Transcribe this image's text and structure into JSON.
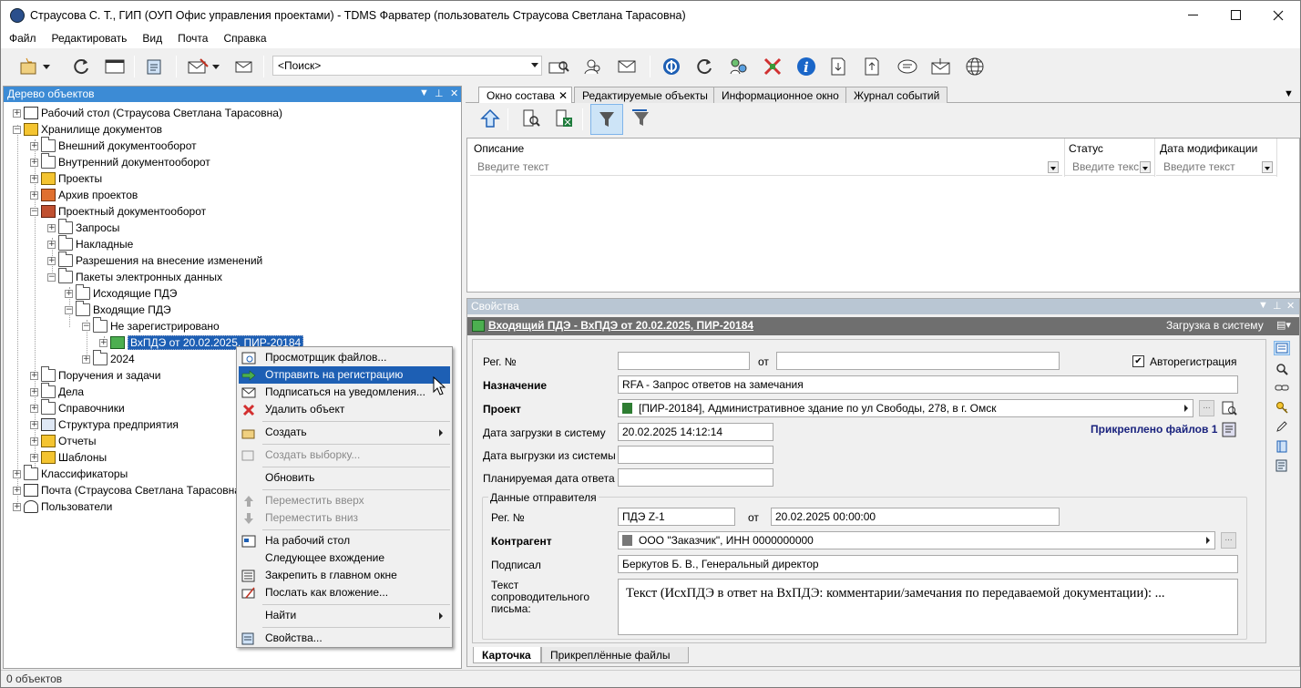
{
  "window": {
    "title": "Страусова С. Т., ГИП (ОУП Офис управления проектами) - TDMS Фарватер (пользователь Страусова Светлана Тарасовна)"
  },
  "menu": [
    "Файл",
    "Редактировать",
    "Вид",
    "Почта",
    "Справка"
  ],
  "search": {
    "value": "<Поиск>"
  },
  "tree": {
    "title": "Дерево объектов",
    "items": [
      "Рабочий стол (Страусова Светлана Тарасовна)",
      "Хранилище документов",
      "Внешний документооборот",
      "Внутренний документооборот",
      "Проекты",
      "Архив проектов",
      "Проектный документооборот",
      "Запросы",
      "Накладные",
      "Разрешения на внесение изменений",
      "Пакеты электронных данных",
      "Исходящие ПДЭ",
      "Входящие ПДЭ",
      "Не зарегистрировано",
      "ВхПДЭ от 20.02.2025, ПИР-20184",
      "2024",
      "Поручения и задачи",
      "Дела",
      "Справочники",
      "Структура предприятия",
      "Отчеты",
      "Шаблоны",
      "Классификаторы",
      "Почта (Страусова Светлана Тарасовна)",
      "Пользователи"
    ]
  },
  "tabs": [
    "Окно состава",
    "Редактируемые объекты",
    "Информационное окно",
    "Журнал событий"
  ],
  "grid": {
    "columns": [
      "Описание",
      "Статус",
      "Дата модификации"
    ],
    "filter_placeholders": [
      "Введите текст",
      "Введите текс",
      "Введите текст"
    ]
  },
  "props": {
    "title": "Свойства",
    "object": "Входящий ПДЭ - ВхПДЭ от 20.02.2025, ПИР-20184",
    "action": "Загрузка в систему",
    "reg_no_label": "Рег. №",
    "from_label": "от",
    "autoreg_label": "Авторегистрация",
    "purpose_label": "Назначение",
    "purpose_value": "RFA - Запрос ответов на замечания",
    "project_label": "Проект",
    "project_value": "[ПИР-20184], Административное здание по ул Свободы, 278, в г. Омск",
    "upload_date_label": "Дата загрузки в систему",
    "upload_date_value": "20.02.2025 14:12:14",
    "attached_files": "Прикреплено файлов 1",
    "download_date_label": "Дата выгрузки из системы",
    "planned_answer_label": "Планируемая дата ответа",
    "sender_group": "Данные отправителя",
    "sender_reg_label": "Рег. №",
    "sender_reg_value": "ПДЭ Z-1",
    "sender_from_label": "от",
    "sender_date_value": "20.02.2025 00:00:00",
    "contractor_label": "Контрагент",
    "contractor_value": "ООО \"Заказчик\", ИНН 0000000000",
    "signed_label": "Подписал",
    "signed_value": "Беркутов Б. В., Генеральный директор",
    "letter_label": "Текст сопроводительного письма:",
    "letter_value": "Текст (ИсхПДЭ в ответ на ВхПДЭ: комментарии/замечания по передаваемой документации): ...",
    "bottom_tabs": [
      "Карточка",
      "Прикреплённые файлы"
    ]
  },
  "context_menu": [
    {
      "label": "Просмотрщик файлов...",
      "icon": "file-viewer-icon"
    },
    {
      "label": "Отправить на регистрацию",
      "icon": "green-arrow-icon",
      "selected": true
    },
    {
      "label": "Подписаться на уведомления...",
      "icon": "envelope-subscribe-icon"
    },
    {
      "label": "Удалить объект",
      "icon": "delete-x-icon"
    },
    {
      "label": "Создать",
      "icon": "create-icon",
      "submenu": true
    },
    {
      "label": "Создать выборку...",
      "icon": "query-icon",
      "disabled": true
    },
    {
      "label": "Обновить"
    },
    {
      "label": "Переместить вверх",
      "icon": "arrow-up-icon",
      "disabled": true
    },
    {
      "label": "Переместить вниз",
      "icon": "arrow-down-icon",
      "disabled": true
    },
    {
      "label": "На рабочий стол",
      "icon": "desktop-icon"
    },
    {
      "label": "Следующее вхождение"
    },
    {
      "label": "Закрепить в главном окне",
      "icon": "pin-window-icon"
    },
    {
      "label": "Послать как вложение...",
      "icon": "send-attachment-icon"
    },
    {
      "label": "Найти",
      "submenu": true
    },
    {
      "label": "Свойства...",
      "icon": "properties-icon"
    }
  ],
  "status": "0 объектов",
  "colors": {
    "selection": "#1d5fb4",
    "panel_header": "#3c8bd5",
    "object_bar": "#6f6f6f"
  }
}
